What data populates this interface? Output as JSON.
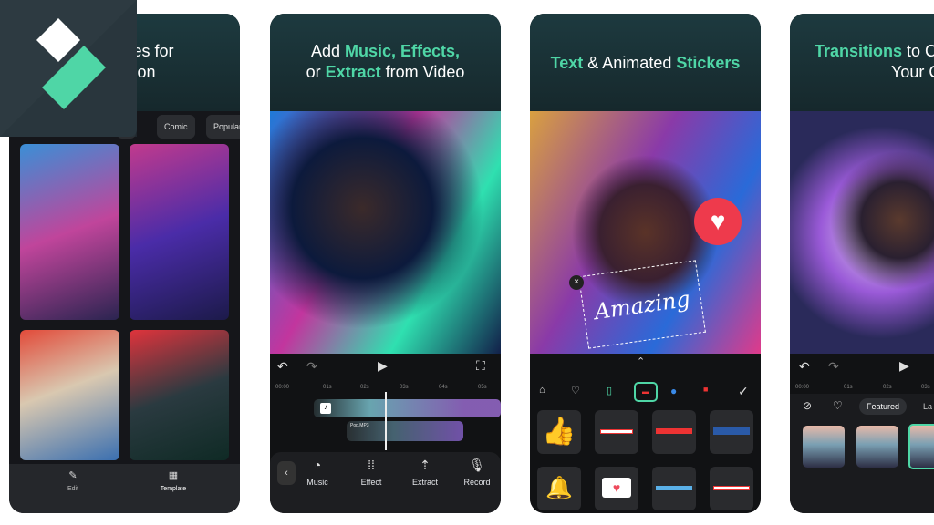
{
  "accent": "#4fd6a6",
  "panels": [
    {
      "headline_line1": "Templates for",
      "headline_line2": "Creation",
      "chips": [
        "k",
        "Comic",
        "Popular"
      ],
      "nav": [
        "Edit",
        "Template"
      ]
    },
    {
      "headline_pre1": "Add ",
      "h1": "Music, Effects,",
      "headline_pre2": "or ",
      "h2": "Extract",
      "headline_post2": " from Video",
      "times": [
        "00:00",
        "01s",
        "02s",
        "03s",
        "04s",
        "05s"
      ],
      "track": "Pop.MP3",
      "tools": [
        "Music",
        "Effect",
        "Extract",
        "Record"
      ]
    },
    {
      "h1": "Text",
      "mid": " & Animated ",
      "h2": "Stickers",
      "sticker_text": "Amazing"
    },
    {
      "h1": "Transitions",
      "post1": " to C",
      "line2": "Your Clip",
      "times": [
        "00:00",
        "01s",
        "02s",
        "03s"
      ],
      "tabs": [
        "Featured",
        "La"
      ]
    }
  ]
}
